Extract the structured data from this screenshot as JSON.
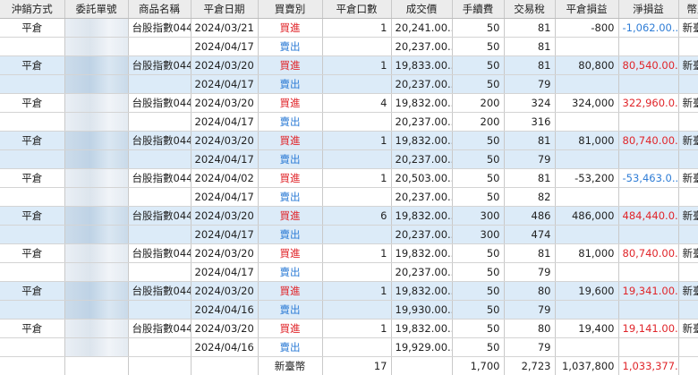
{
  "columns": [
    "沖銷方式",
    "委託單號",
    "商品名稱",
    "平倉日期",
    "買賣別",
    "平倉口數",
    "成交價",
    "手續費",
    "交易稅",
    "平倉損益",
    "淨損益",
    "幣別"
  ],
  "colors": {
    "buy": "#e0252a",
    "sell": "#2f7dd6",
    "loss": "#2f7dd6",
    "gain": "#e0252a",
    "stripe": "#dcebf8"
  },
  "rows": [
    {
      "method": "平倉",
      "product": "台股指數044",
      "date": "2024/03/21",
      "side": "買進",
      "qty": "1",
      "price": "20,241.00...",
      "fee": "50",
      "tax": "81",
      "pnl": "-800",
      "net": "-1,062.00...",
      "net_sign": "neg",
      "currency": "新臺幣",
      "stripe": 0,
      "first": true
    },
    {
      "method": "",
      "product": "",
      "date": "2024/04/17",
      "side": "賣出",
      "qty": "",
      "price": "20,237.00...",
      "fee": "50",
      "tax": "81",
      "pnl": "",
      "net": "",
      "net_sign": "",
      "currency": "",
      "stripe": 0,
      "first": false
    },
    {
      "method": "平倉",
      "product": "台股指數044",
      "date": "2024/03/20",
      "side": "買進",
      "qty": "1",
      "price": "19,833.00...",
      "fee": "50",
      "tax": "81",
      "pnl": "80,800",
      "net": "80,540.00...",
      "net_sign": "pos",
      "currency": "新臺幣",
      "stripe": 1,
      "first": true
    },
    {
      "method": "",
      "product": "",
      "date": "2024/04/17",
      "side": "賣出",
      "qty": "",
      "price": "20,237.00...",
      "fee": "50",
      "tax": "79",
      "pnl": "",
      "net": "",
      "net_sign": "",
      "currency": "",
      "stripe": 1,
      "first": false
    },
    {
      "method": "平倉",
      "product": "台股指數044",
      "date": "2024/03/20",
      "side": "買進",
      "qty": "4",
      "price": "19,832.00...",
      "fee": "200",
      "tax": "324",
      "pnl": "324,000",
      "net": "322,960.0...",
      "net_sign": "pos",
      "currency": "新臺幣",
      "stripe": 0,
      "first": true
    },
    {
      "method": "",
      "product": "",
      "date": "2024/04/17",
      "side": "賣出",
      "qty": "",
      "price": "20,237.00...",
      "fee": "200",
      "tax": "316",
      "pnl": "",
      "net": "",
      "net_sign": "",
      "currency": "",
      "stripe": 0,
      "first": false
    },
    {
      "method": "平倉",
      "product": "台股指數044",
      "date": "2024/03/20",
      "side": "買進",
      "qty": "1",
      "price": "19,832.00...",
      "fee": "50",
      "tax": "81",
      "pnl": "81,000",
      "net": "80,740.00...",
      "net_sign": "pos",
      "currency": "新臺幣",
      "stripe": 1,
      "first": true
    },
    {
      "method": "",
      "product": "",
      "date": "2024/04/17",
      "side": "賣出",
      "qty": "",
      "price": "20,237.00...",
      "fee": "50",
      "tax": "79",
      "pnl": "",
      "net": "",
      "net_sign": "",
      "currency": "",
      "stripe": 1,
      "first": false
    },
    {
      "method": "平倉",
      "product": "台股指數044",
      "date": "2024/04/02",
      "side": "買進",
      "qty": "1",
      "price": "20,503.00...",
      "fee": "50",
      "tax": "81",
      "pnl": "-53,200",
      "net": "-53,463.0...",
      "net_sign": "neg",
      "currency": "新臺幣",
      "stripe": 0,
      "first": true
    },
    {
      "method": "",
      "product": "",
      "date": "2024/04/17",
      "side": "賣出",
      "qty": "",
      "price": "20,237.00...",
      "fee": "50",
      "tax": "82",
      "pnl": "",
      "net": "",
      "net_sign": "",
      "currency": "",
      "stripe": 0,
      "first": false
    },
    {
      "method": "平倉",
      "product": "台股指數044",
      "date": "2024/03/20",
      "side": "買進",
      "qty": "6",
      "price": "19,832.00...",
      "fee": "300",
      "tax": "486",
      "pnl": "486,000",
      "net": "484,440.0...",
      "net_sign": "pos",
      "currency": "新臺幣",
      "stripe": 1,
      "first": true
    },
    {
      "method": "",
      "product": "",
      "date": "2024/04/17",
      "side": "賣出",
      "qty": "",
      "price": "20,237.00...",
      "fee": "300",
      "tax": "474",
      "pnl": "",
      "net": "",
      "net_sign": "",
      "currency": "",
      "stripe": 1,
      "first": false
    },
    {
      "method": "平倉",
      "product": "台股指數044",
      "date": "2024/03/20",
      "side": "買進",
      "qty": "1",
      "price": "19,832.00...",
      "fee": "50",
      "tax": "81",
      "pnl": "81,000",
      "net": "80,740.00...",
      "net_sign": "pos",
      "currency": "新臺幣",
      "stripe": 0,
      "first": true
    },
    {
      "method": "",
      "product": "",
      "date": "2024/04/17",
      "side": "賣出",
      "qty": "",
      "price": "20,237.00...",
      "fee": "50",
      "tax": "79",
      "pnl": "",
      "net": "",
      "net_sign": "",
      "currency": "",
      "stripe": 0,
      "first": false
    },
    {
      "method": "平倉",
      "product": "台股指數044",
      "date": "2024/03/20",
      "side": "買進",
      "qty": "1",
      "price": "19,832.00...",
      "fee": "50",
      "tax": "80",
      "pnl": "19,600",
      "net": "19,341.00...",
      "net_sign": "pos",
      "currency": "新臺幣",
      "stripe": 1,
      "first": true
    },
    {
      "method": "",
      "product": "",
      "date": "2024/04/16",
      "side": "賣出",
      "qty": "",
      "price": "19,930.00...",
      "fee": "50",
      "tax": "79",
      "pnl": "",
      "net": "",
      "net_sign": "",
      "currency": "",
      "stripe": 1,
      "first": false
    },
    {
      "method": "平倉",
      "product": "台股指數044",
      "date": "2024/03/20",
      "side": "買進",
      "qty": "1",
      "price": "19,832.00...",
      "fee": "50",
      "tax": "80",
      "pnl": "19,400",
      "net": "19,141.00...",
      "net_sign": "pos",
      "currency": "新臺幣",
      "stripe": 0,
      "first": true
    },
    {
      "method": "",
      "product": "",
      "date": "2024/04/16",
      "side": "賣出",
      "qty": "",
      "price": "19,929.00...",
      "fee": "50",
      "tax": "79",
      "pnl": "",
      "net": "",
      "net_sign": "",
      "currency": "",
      "stripe": 0,
      "first": false
    }
  ],
  "totals": {
    "currency": "新臺幣",
    "qty": "17",
    "fee": "1,700",
    "tax": "2,723",
    "pnl": "1,037,800",
    "net": "1,033,377...."
  }
}
